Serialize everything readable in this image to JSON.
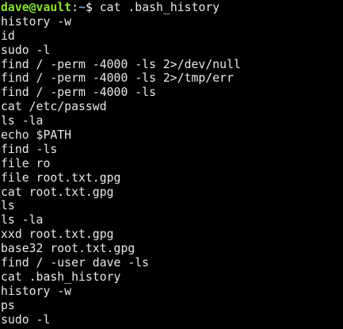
{
  "colors": {
    "background": "#000000",
    "foreground": "#e8e8e8",
    "prompt_user_host": "#8ae234",
    "prompt_path": "#729fcf"
  },
  "prompt": {
    "user_host": "dave@vault",
    "separator": ":",
    "path": "~",
    "symbol": "$ ",
    "command": "cat .bash_history"
  },
  "history_lines": [
    "history -w",
    "id",
    "sudo -l",
    "find / -perm -4000 -ls 2>/dev/null",
    "find / -perm -4000 -ls 2>/tmp/err",
    "find / -perm -4000 -ls",
    "cat /etc/passwd",
    "ls -la",
    "echo $PATH",
    "find -ls",
    "file ro",
    "file root.txt.gpg",
    "cat root.txt.gpg",
    "ls",
    "ls -la",
    "xxd root.txt.gpg",
    "base32 root.txt.gpg",
    "find / -user dave -ls",
    "cat .bash_history",
    "history -w",
    "ps",
    "sudo -l"
  ]
}
